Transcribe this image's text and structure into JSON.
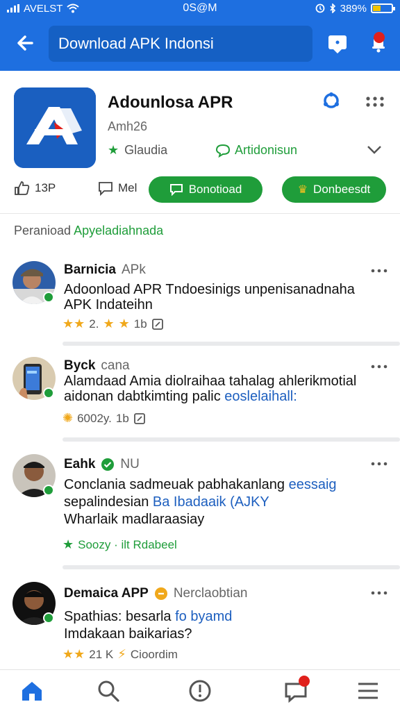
{
  "status_bar": {
    "carrier": "AVELST",
    "time": "0S@M",
    "battery": "389%"
  },
  "header": {
    "search_value": "Download APK Indonsi"
  },
  "app": {
    "title": "Adounlosa APR",
    "subtitle": "Amh26",
    "rating_label": "Glaudia",
    "announce_label": "Artidonisun",
    "stat_1": "13P",
    "stat_2": "Mel",
    "download_button": "Bonotioad",
    "install_button": "Donbeesdt"
  },
  "section": {
    "label_prefix": "Peranioad ",
    "label_accent": "Apyeladiahnada"
  },
  "posts": [
    {
      "name": "Barnicia",
      "name_sub": "APk",
      "line1": "Adoonload APR Tndoesinigs unpenisanadnaha",
      "line2": "APK Indateihn",
      "meta_rating": "2.",
      "meta_count": "1b"
    },
    {
      "name": "Byck",
      "name_sub": "cana",
      "line1": "Alamdaad Amia diolraihaa tahalag ahlerikmotial",
      "line2_plain": "aidonan dabtkimting palic ",
      "line2_link": "eoslelaihall:",
      "meta_rating": "6002y.",
      "meta_count": "1b"
    },
    {
      "name": "Eahk",
      "name_sub": "NU",
      "line1_plain": "Conclania sadmeuak pabhakanlang ",
      "line1_link": "eessaig",
      "line2_plain": "sepalindesian ",
      "line2_link": "Ba Ibadaaik (AJKY",
      "line3": "Wharlaik madlaraasiay",
      "meta": "Soozy · ilt Rdabeel"
    },
    {
      "name": "Demaica APP",
      "name_sub": "Nerclaobtian",
      "line1_plain": "Spathias: besarla ",
      "line1_link": "fo byamd",
      "line2": "Imdakaan baikarias?",
      "meta_rating": "21 K",
      "meta_extra": "Cioordim"
    }
  ],
  "colors": {
    "brand_blue": "#1e6fe0",
    "green": "#1f9d3a",
    "star": "#f0a81b",
    "badge": "#e0201b"
  },
  "icons": {
    "back": "arrow-left-icon",
    "message": "message-icon",
    "notification": "bell-icon",
    "share": "share-icon",
    "more": "more-dots-icon",
    "nav": [
      "home-icon",
      "search-icon",
      "alert-circle-icon",
      "chat-icon",
      "menu-icon"
    ]
  }
}
